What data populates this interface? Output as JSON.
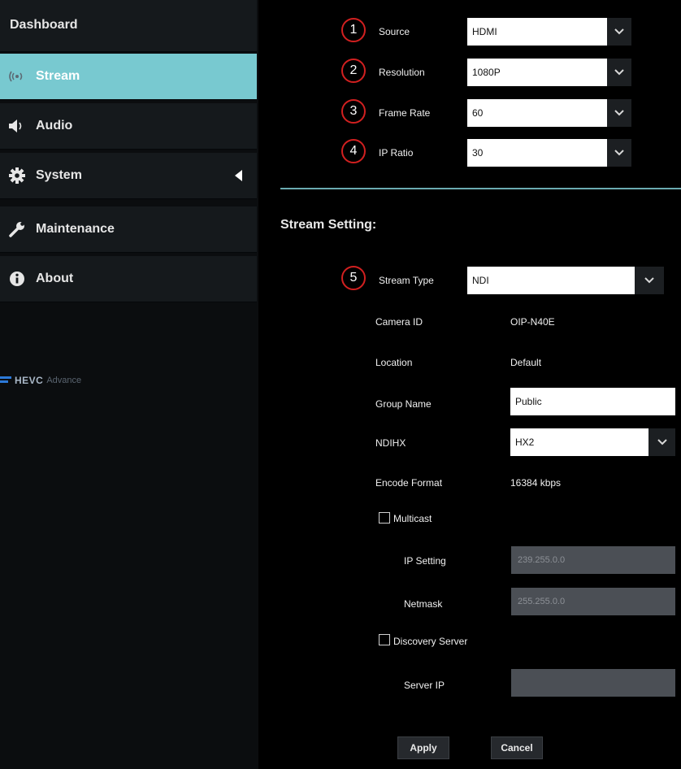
{
  "sidebar": {
    "items": [
      {
        "label": "Dashboard",
        "icon": "none"
      },
      {
        "label": "Stream",
        "icon": "broadcast-icon",
        "active": true
      },
      {
        "label": "Audio",
        "icon": "speaker-icon"
      },
      {
        "label": "System",
        "icon": "gear-icon"
      },
      {
        "label": "Maintenance",
        "icon": "wrench-icon"
      },
      {
        "label": "About",
        "icon": "info-icon"
      }
    ],
    "logo": {
      "brand": "HEVC",
      "tagline": "Advance"
    }
  },
  "top": {
    "rows": [
      {
        "marker": "1",
        "label": "Source",
        "value": "HDMI"
      },
      {
        "marker": "2",
        "label": "Resolution",
        "value": "1080P"
      },
      {
        "marker": "3",
        "label": "Frame Rate",
        "value": "60"
      },
      {
        "marker": "4",
        "label": "IP Ratio",
        "value": "30"
      }
    ]
  },
  "stream": {
    "title": "Stream Setting:",
    "type": {
      "marker": "5",
      "label": "Stream Type",
      "value": "NDI"
    },
    "camera_id": {
      "label": "Camera ID",
      "value": "OIP-N40E"
    },
    "location": {
      "label": "Location",
      "value": "Default"
    },
    "group_name": {
      "label": "Group Name",
      "value": "Public"
    },
    "ndihx": {
      "label": "NDIHX",
      "value": "HX2"
    },
    "encode_format": {
      "label": "Encode Format",
      "value": "16384 kbps"
    },
    "multicast": {
      "label": "Multicast",
      "checked": false
    },
    "ip_setting": {
      "label": "IP Setting",
      "value": "239.255.0.0"
    },
    "netmask": {
      "label": "Netmask",
      "value": "255.255.0.0"
    },
    "discovery": {
      "label": "Discovery Server",
      "checked": false
    },
    "server_ip": {
      "label": "Server IP",
      "value": ""
    }
  },
  "actions": {
    "apply": "Apply",
    "cancel": "Cancel"
  },
  "colors": {
    "active_nav": "#78c9d0",
    "marker_ring": "#d22020",
    "divider": "#6aaab0"
  }
}
